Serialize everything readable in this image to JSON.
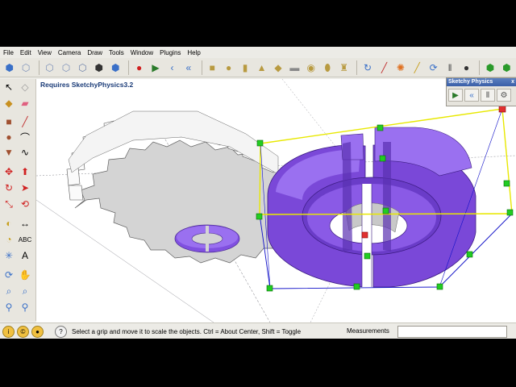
{
  "menu": [
    "File",
    "Edit",
    "View",
    "Camera",
    "Draw",
    "Tools",
    "Window",
    "Plugins",
    "Help"
  ],
  "viewport": {
    "notice": "Requires SketchyPhysics3.2"
  },
  "sketchy_panel": {
    "title": "Sketchy Physics",
    "close": "x"
  },
  "status": {
    "hint": "Select a grip and move it to scale the objects. Ctrl = About Center, Shift = Toggle",
    "measurements_label": "Measurements"
  },
  "colors": {
    "gear": "#d8d8d8",
    "purple": "#8a57e6",
    "grip": "#22cc22",
    "bbox": "#f2f200"
  }
}
